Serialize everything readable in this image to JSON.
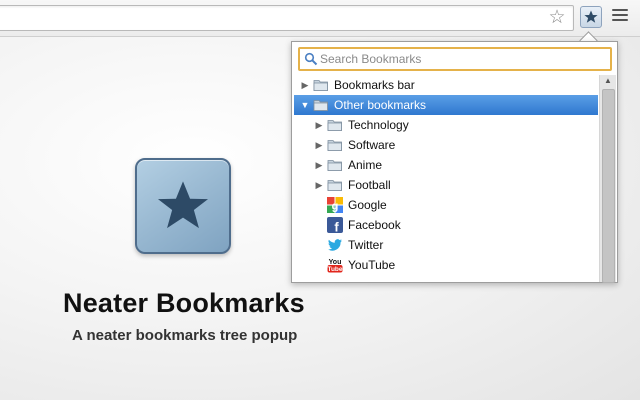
{
  "toolbar": {
    "omnibox_value": "",
    "bookmark_star_icon": "star-outline-icon",
    "extension_icon": "star-icon",
    "menu_icon": "hamburger-menu-icon"
  },
  "popup": {
    "search": {
      "placeholder": "Search Bookmarks",
      "value": "",
      "icon": "search-icon"
    },
    "tree": [
      {
        "label": "Bookmarks bar",
        "type": "folder",
        "depth": 0,
        "expanded": false
      },
      {
        "label": "Other bookmarks",
        "type": "folder",
        "depth": 0,
        "expanded": true,
        "selected": true
      },
      {
        "label": "Technology",
        "type": "folder",
        "depth": 1,
        "expanded": false
      },
      {
        "label": "Software",
        "type": "folder",
        "depth": 1,
        "expanded": false
      },
      {
        "label": "Anime",
        "type": "folder",
        "depth": 1,
        "expanded": false
      },
      {
        "label": "Football",
        "type": "folder",
        "depth": 1,
        "expanded": false
      },
      {
        "label": "Google",
        "type": "link",
        "depth": 1,
        "icon": "google-favicon-icon"
      },
      {
        "label": "Facebook",
        "type": "link",
        "depth": 1,
        "icon": "facebook-favicon-icon"
      },
      {
        "label": "Twitter",
        "type": "link",
        "depth": 1,
        "icon": "twitter-favicon-icon"
      },
      {
        "label": "YouTube",
        "type": "link",
        "depth": 1,
        "icon": "youtube-favicon-icon"
      }
    ]
  },
  "promo": {
    "title": "Neater Bookmarks",
    "subtitle": "A neater bookmarks tree popup",
    "icon": "star-icon"
  },
  "colors": {
    "selection": "#3b86d8",
    "search_border": "#e5b24a",
    "icon_star": "#2d4a66"
  }
}
